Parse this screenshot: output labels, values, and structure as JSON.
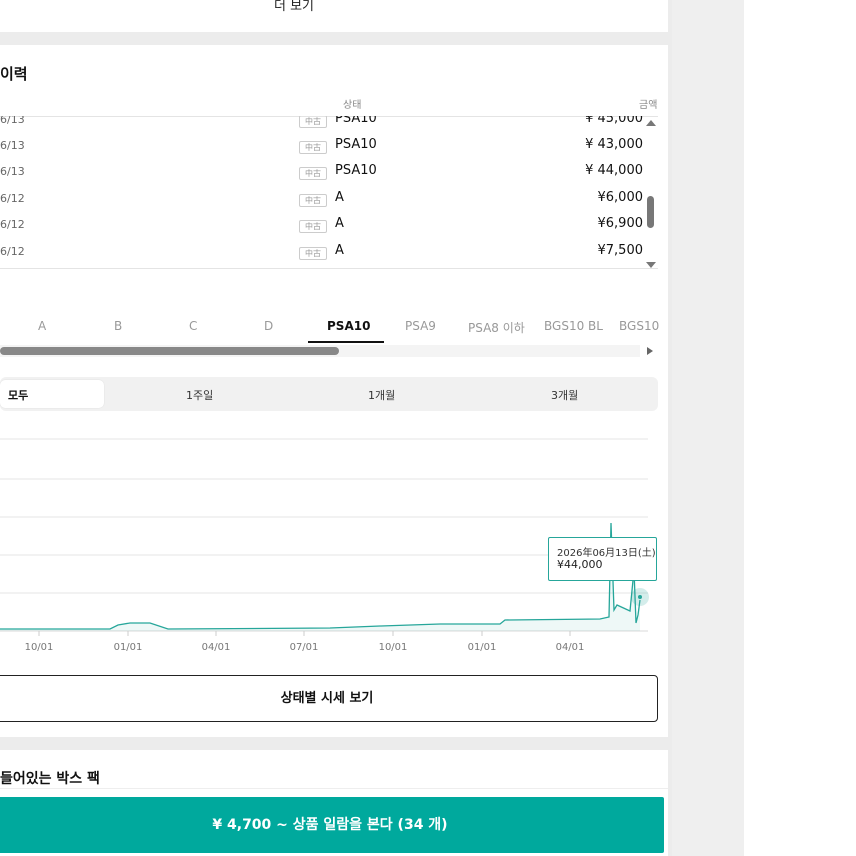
{
  "more": {
    "label": "더 보기"
  },
  "history": {
    "title": "이력",
    "col_status": "상태",
    "col_price": "금액",
    "rows": [
      {
        "date": "6/13",
        "badge": "中古",
        "grade": "PSA10",
        "price": "¥ 45,000"
      },
      {
        "date": "6/13",
        "badge": "中古",
        "grade": "PSA10",
        "price": "¥ 43,000"
      },
      {
        "date": "6/13",
        "badge": "中古",
        "grade": "PSA10",
        "price": "¥ 44,000"
      },
      {
        "date": "6/12",
        "badge": "中古",
        "grade": "A",
        "price": "¥6,000"
      },
      {
        "date": "6/12",
        "badge": "中古",
        "grade": "A",
        "price": "¥6,900"
      },
      {
        "date": "6/12",
        "badge": "中古",
        "grade": "A",
        "price": "¥7,500"
      }
    ]
  },
  "grade_tabs": {
    "items": [
      "A",
      "B",
      "C",
      "D",
      "PSA10",
      "PSA9",
      "PSA8 이하",
      "BGS10 BL",
      "BGS10"
    ],
    "active": "PSA10"
  },
  "period_tabs": {
    "items": [
      "모두",
      "1주일",
      "1개월",
      "3개월"
    ],
    "active": "모두"
  },
  "chart_data": {
    "type": "line",
    "x_tick_labels": [
      "10/01",
      "01/01",
      "04/01",
      "07/01",
      "10/01",
      "01/01",
      "04/01"
    ],
    "tooltip": {
      "date": "2026年06月13日(土)",
      "value": "¥44,000"
    },
    "line_color": "#26a69a",
    "grid": true
  },
  "state_button": {
    "label": "상태별 시세 보기"
  },
  "box_section": {
    "title": "들어있는 박스 팩"
  },
  "cta": {
    "label": "¥ 4,700 ~   상품 일람을 본다 (34 개)"
  }
}
